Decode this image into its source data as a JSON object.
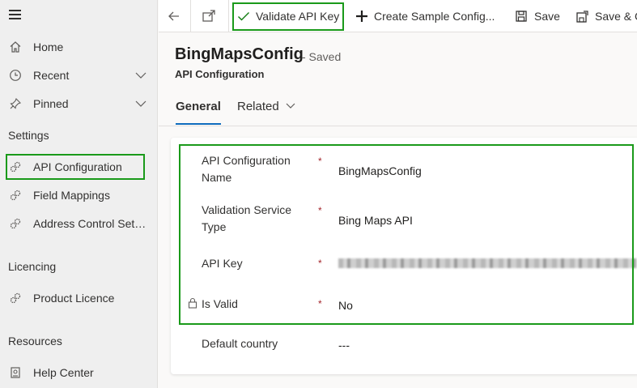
{
  "sidebar": {
    "items": [
      {
        "label": "Home"
      },
      {
        "label": "Recent"
      },
      {
        "label": "Pinned"
      }
    ],
    "sections": [
      {
        "title": "Settings",
        "items": [
          {
            "label": "API Configuration"
          },
          {
            "label": "Field Mappings"
          },
          {
            "label": "Address Control Sett..."
          }
        ]
      },
      {
        "title": "Licencing",
        "items": [
          {
            "label": "Product Licence"
          }
        ]
      },
      {
        "title": "Resources",
        "items": [
          {
            "label": "Help Center"
          }
        ]
      }
    ]
  },
  "toolbar": {
    "validate_label": "Validate API Key",
    "create_label": "Create Sample Config...",
    "save_label": "Save",
    "save_close_label": "Save & C"
  },
  "record": {
    "title": "BingMapsConfig",
    "status": "- Saved",
    "entity": "API Configuration"
  },
  "tabs": [
    {
      "label": "General"
    },
    {
      "label": "Related"
    }
  ],
  "form": {
    "fields": [
      {
        "label_line1": "API Configuration",
        "label_line2": "Name",
        "value": "BingMapsConfig",
        "required": "*"
      },
      {
        "label_line1": "Validation Service",
        "label_line2": "Type",
        "value": "Bing Maps API",
        "required": "*"
      },
      {
        "label": "API Key",
        "required": "*"
      },
      {
        "label": "Is Valid",
        "value": "No",
        "required": "*"
      },
      {
        "label": "Default country",
        "value": "---"
      }
    ]
  },
  "colors": {
    "highlight": "#1a9a1a",
    "accent": "#0f6cbd",
    "required": "#a4262c"
  }
}
